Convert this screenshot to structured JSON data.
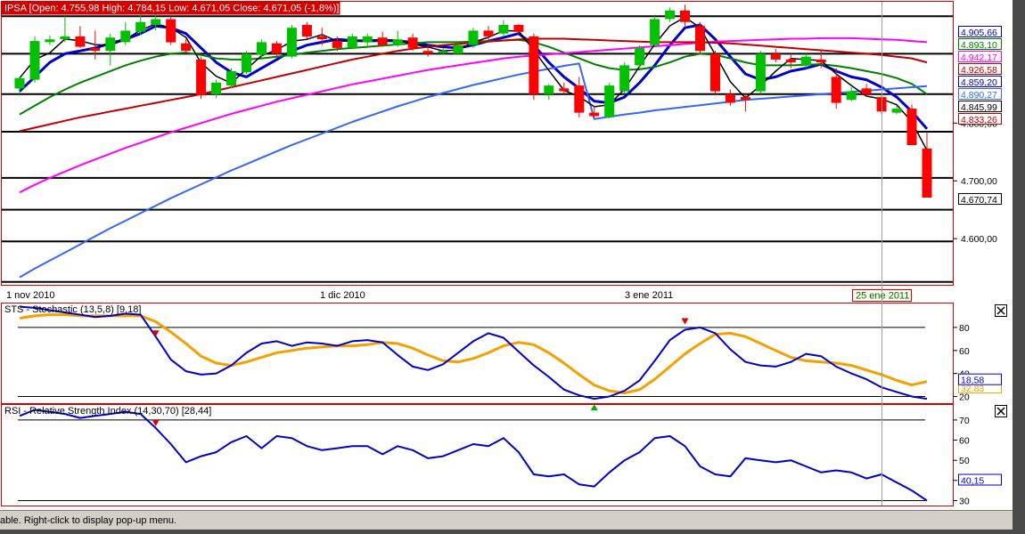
{
  "status_text": "able. Right-click to display pop-up menu.",
  "colors": {
    "panel_border": "#d40000",
    "up_candle": "#00c000",
    "down_candle": "#ff0000",
    "ma3": "#000000",
    "ma5": "#0000c8",
    "ma20": "#008000",
    "ma50": "#ff00ff",
    "ma40": "#c00000",
    "ma_long1": "#3366ff",
    "ma_long2": "#3366dd",
    "stoch_k": "#0000c8",
    "stoch_d": "#f5a000",
    "rsi": "#0000c8"
  },
  "panels": {
    "price": {
      "title": "IPSA [Open: 4.755,98  High: 4.784,15  Low: 4.671,05  Close: 4.671,05 (-1,8%)]",
      "y_ticks": [
        "4.800,00",
        "4.700,00",
        "4.600,00"
      ],
      "x_labels": [
        "1 nov 2010",
        "1 dic 2010",
        "3 ene 2011"
      ],
      "x_highlight_label": "25 ene 2011",
      "value_tags": [
        {
          "text": "4.905,66",
          "color": "#0000c8"
        },
        {
          "text": "4.893,10",
          "color": "#008000"
        },
        {
          "text": "4.942,17",
          "color": "#ff00ff"
        },
        {
          "text": "4.926,58",
          "color": "#c00000"
        },
        {
          "text": "4.859,20",
          "color": "#0000c8"
        },
        {
          "text": "4.890,27",
          "color": "#3366ff"
        },
        {
          "text": "4.845,99",
          "color": "#000000"
        },
        {
          "text": "4.833,26",
          "color": "#c00000"
        },
        {
          "text": "4.670,74",
          "color": "#000000"
        }
      ]
    },
    "stochastic": {
      "title": "STS - Stochastic (13,5,8) [9,18]",
      "y_ticks": [
        "80",
        "60",
        "40",
        "20"
      ],
      "value_tags": [
        {
          "text": "32,83",
          "color": "#f5a000"
        },
        {
          "text": "18,58",
          "color": "#0000c8"
        }
      ]
    },
    "rsi": {
      "title": "RSI - Relative Strength Index (14,30,70) [28,44]",
      "y_ticks": [
        "70",
        "60",
        "50",
        "40",
        "30"
      ],
      "value_tags": [
        {
          "text": "40,15",
          "color": "#0000c8"
        }
      ]
    }
  },
  "chart_data": [
    {
      "type": "candlestick",
      "title": "IPSA [Open: 4.755,98  High: 4.784,15  Low: 4.671,05  Close: 4.671,05 (-1,8%)]",
      "ylim": [
        4520,
        5010
      ],
      "y_ticks": [
        4800,
        4700,
        4600
      ],
      "x_labels": [
        {
          "label": "1 nov 2010",
          "index": 0
        },
        {
          "label": "1 dic 2010",
          "index": 21
        },
        {
          "label": "3 ene 2011",
          "index": 41
        },
        {
          "label": "25 ene 2011",
          "index": 57
        }
      ],
      "candles": [
        {
          "o": 4860,
          "h": 4880,
          "l": 4850,
          "c": 4878
        },
        {
          "o": 4875,
          "h": 4950,
          "l": 4870,
          "c": 4942
        },
        {
          "o": 4940,
          "h": 4952,
          "l": 4935,
          "c": 4945
        },
        {
          "o": 4945,
          "h": 4985,
          "l": 4940,
          "c": 4950
        },
        {
          "o": 4950,
          "h": 4968,
          "l": 4930,
          "c": 4932
        },
        {
          "o": 4930,
          "h": 4960,
          "l": 4910,
          "c": 4925
        },
        {
          "o": 4925,
          "h": 4955,
          "l": 4900,
          "c": 4948
        },
        {
          "o": 4940,
          "h": 4975,
          "l": 4935,
          "c": 4960
        },
        {
          "o": 4958,
          "h": 4995,
          "l": 4952,
          "c": 4975
        },
        {
          "o": 4970,
          "h": 4990,
          "l": 4960,
          "c": 4980
        },
        {
          "o": 4980,
          "h": 4985,
          "l": 4935,
          "c": 4940
        },
        {
          "o": 4938,
          "h": 4945,
          "l": 4920,
          "c": 4925
        },
        {
          "o": 4910,
          "h": 4915,
          "l": 4842,
          "c": 4848
        },
        {
          "o": 4850,
          "h": 4875,
          "l": 4843,
          "c": 4870
        },
        {
          "o": 4865,
          "h": 4895,
          "l": 4860,
          "c": 4890
        },
        {
          "o": 4888,
          "h": 4925,
          "l": 4885,
          "c": 4920
        },
        {
          "o": 4918,
          "h": 4945,
          "l": 4910,
          "c": 4940
        },
        {
          "o": 4938,
          "h": 4942,
          "l": 4915,
          "c": 4920
        },
        {
          "o": 4915,
          "h": 4970,
          "l": 4912,
          "c": 4965
        },
        {
          "o": 4970,
          "h": 4975,
          "l": 4945,
          "c": 4950
        },
        {
          "o": 4950,
          "h": 4965,
          "l": 4935,
          "c": 4945
        },
        {
          "o": 4942,
          "h": 4950,
          "l": 4925,
          "c": 4930
        },
        {
          "o": 4930,
          "h": 4955,
          "l": 4928,
          "c": 4950
        },
        {
          "o": 4940,
          "h": 4955,
          "l": 4932,
          "c": 4950
        },
        {
          "o": 4948,
          "h": 4958,
          "l": 4932,
          "c": 4935
        },
        {
          "o": 4935,
          "h": 4960,
          "l": 4932,
          "c": 4945
        },
        {
          "o": 4948,
          "h": 4955,
          "l": 4925,
          "c": 4930
        },
        {
          "o": 4925,
          "h": 4935,
          "l": 4915,
          "c": 4920
        },
        {
          "o": 4922,
          "h": 4930,
          "l": 4918,
          "c": 4925
        },
        {
          "o": 4920,
          "h": 4938,
          "l": 4918,
          "c": 4935
        },
        {
          "o": 4935,
          "h": 4965,
          "l": 4930,
          "c": 4960
        },
        {
          "o": 4960,
          "h": 4968,
          "l": 4945,
          "c": 4950
        },
        {
          "o": 4955,
          "h": 4978,
          "l": 4950,
          "c": 4970
        },
        {
          "o": 4970,
          "h": 4972,
          "l": 4955,
          "c": 4958
        },
        {
          "o": 4950,
          "h": 4955,
          "l": 4840,
          "c": 4850
        },
        {
          "o": 4850,
          "h": 4868,
          "l": 4840,
          "c": 4865
        },
        {
          "o": 4860,
          "h": 4870,
          "l": 4850,
          "c": 4855
        },
        {
          "o": 4865,
          "h": 4880,
          "l": 4810,
          "c": 4818
        },
        {
          "o": 4818,
          "h": 4830,
          "l": 4810,
          "c": 4812
        },
        {
          "o": 4810,
          "h": 4870,
          "l": 4808,
          "c": 4865
        },
        {
          "o": 4855,
          "h": 4905,
          "l": 4850,
          "c": 4900
        },
        {
          "o": 4900,
          "h": 4935,
          "l": 4895,
          "c": 4930
        },
        {
          "o": 4935,
          "h": 4985,
          "l": 4932,
          "c": 4980
        },
        {
          "o": 4980,
          "h": 5000,
          "l": 4975,
          "c": 4995
        },
        {
          "o": 4995,
          "h": 5005,
          "l": 4968,
          "c": 4975
        },
        {
          "o": 4968,
          "h": 4975,
          "l": 4920,
          "c": 4925
        },
        {
          "o": 4920,
          "h": 4925,
          "l": 4850,
          "c": 4855
        },
        {
          "o": 4850,
          "h": 4858,
          "l": 4830,
          "c": 4835
        },
        {
          "o": 4845,
          "h": 4852,
          "l": 4820,
          "c": 4840
        },
        {
          "o": 4855,
          "h": 4925,
          "l": 4850,
          "c": 4920
        },
        {
          "o": 4920,
          "h": 4928,
          "l": 4905,
          "c": 4910
        },
        {
          "o": 4910,
          "h": 4920,
          "l": 4895,
          "c": 4905
        },
        {
          "o": 4900,
          "h": 4920,
          "l": 4895,
          "c": 4915
        },
        {
          "o": 4910,
          "h": 4925,
          "l": 4895,
          "c": 4905
        },
        {
          "o": 4880,
          "h": 4895,
          "l": 4825,
          "c": 4835
        },
        {
          "o": 4840,
          "h": 4862,
          "l": 4838,
          "c": 4855
        },
        {
          "o": 4860,
          "h": 4868,
          "l": 4845,
          "c": 4850
        },
        {
          "o": 4845,
          "h": 4852,
          "l": 4815,
          "c": 4820
        },
        {
          "o": 4818,
          "h": 4830,
          "l": 4815,
          "c": 4825
        },
        {
          "o": 4825,
          "h": 4832,
          "l": 4780,
          "c": 4762
        },
        {
          "o": 4755.98,
          "h": 4784.15,
          "l": 4671.05,
          "c": 4671.05
        }
      ],
      "series": [
        {
          "name": "MA5",
          "values": [
            4855,
            4880,
            4905,
            4920,
            4925,
            4930,
            4938,
            4945,
            4955,
            4968,
            4965,
            4955,
            4930,
            4905,
            4888,
            4880,
            4895,
            4910,
            4925,
            4935,
            4940,
            4945,
            4943,
            4942,
            4943,
            4942,
            4940,
            4935,
            4932,
            4930,
            4935,
            4942,
            4948,
            4955,
            4935,
            4905,
            4880,
            4860,
            4838,
            4835,
            4845,
            4870,
            4900,
            4935,
            4965,
            4970,
            4945,
            4915,
            4885,
            4875,
            4880,
            4890,
            4895,
            4902,
            4890,
            4880,
            4875,
            4862,
            4845,
            4820,
            4790
          ]
        },
        {
          "name": "MA20",
          "values": [
            4815,
            4830,
            4845,
            4858,
            4870,
            4880,
            4890,
            4900,
            4908,
            4915,
            4920,
            4922,
            4918,
            4912,
            4910,
            4910,
            4912,
            4915,
            4918,
            4922,
            4925,
            4928,
            4930,
            4932,
            4934,
            4936,
            4938,
            4940,
            4940,
            4940,
            4941,
            4942,
            4943,
            4944,
            4940,
            4932,
            4922,
            4912,
            4902,
            4895,
            4892,
            4893,
            4897,
            4905,
            4915,
            4920,
            4918,
            4912,
            4905,
            4900,
            4900,
            4900,
            4901,
            4902,
            4899,
            4895,
            4890,
            4885,
            4878,
            4868,
            4850
          ]
        },
        {
          "name": "MA50",
          "values": [
            4680,
            4693,
            4705,
            4716,
            4727,
            4737,
            4747,
            4757,
            4766,
            4775,
            4784,
            4792,
            4800,
            4808,
            4816,
            4823,
            4830,
            4837,
            4843,
            4849,
            4855,
            4861,
            4867,
            4872,
            4877,
            4882,
            4887,
            4892,
            4896,
            4900,
            4904,
            4908,
            4912,
            4915,
            4917,
            4919,
            4921,
            4923,
            4925,
            4927,
            4929,
            4931,
            4933,
            4935,
            4937,
            4939,
            4941,
            4942,
            4943,
            4944,
            4945,
            4946,
            4946,
            4947,
            4947,
            4947,
            4946,
            4945,
            4944,
            4942,
            4940
          ]
        },
        {
          "name": "MA40",
          "values": [
            4786,
            4792,
            4798,
            4804,
            4810,
            4815,
            4820,
            4825,
            4830,
            4835,
            4840,
            4845,
            4850,
            4856,
            4862,
            4868,
            4874,
            4880,
            4886,
            4892,
            4898,
            4904,
            4910,
            4915,
            4920,
            4925,
            4929,
            4932,
            4935,
            4937,
            4939,
            4941,
            4943,
            4945,
            4946,
            4946,
            4946,
            4945,
            4944,
            4943,
            4942,
            4941,
            4940,
            4940,
            4940,
            4940,
            4939,
            4938,
            4936,
            4934,
            4932,
            4930,
            4928,
            4926,
            4924,
            4922,
            4920,
            4918,
            4915,
            4912,
            4905
          ]
        },
        {
          "name": "MA_long",
          "values": [
            4533,
            4548,
            4562,
            4576,
            4590,
            4604,
            4618,
            4631,
            4644,
            4657,
            4670,
            4682,
            4694,
            4706,
            4718,
            4729,
            4740,
            4751,
            4762,
            4772,
            4782,
            4792,
            4802,
            4811,
            4820,
            4829,
            4837,
            4845,
            4852,
            4859,
            4866,
            4872,
            4878,
            4884,
            4889,
            4894,
            4899,
            4903,
            4807,
            4811,
            4815,
            4818,
            4822,
            4825,
            4828,
            4831,
            4834,
            4837,
            4840,
            4842,
            4844,
            4846,
            4848,
            4850,
            4852,
            4854,
            4856,
            4858,
            4860,
            4862,
            4864
          ]
        }
      ]
    },
    {
      "type": "line",
      "title": "STS - Stochastic (13,5,8) [9,18]",
      "ylim": [
        15,
        100
      ],
      "y_ticks": [
        80,
        60,
        40,
        20
      ],
      "series": [
        {
          "name": "%K",
          "values": [
            98,
            97,
            95,
            93,
            91,
            89,
            90,
            92,
            91,
            72,
            52,
            42,
            39,
            40,
            47,
            58,
            66,
            68,
            64,
            67,
            66,
            64,
            68,
            69,
            67,
            56,
            46,
            43,
            48,
            58,
            68,
            75,
            71,
            59,
            47,
            37,
            26,
            21,
            18,
            20,
            25,
            34,
            51,
            69,
            78,
            80,
            75,
            61,
            50,
            47,
            46,
            50,
            57,
            55,
            46,
            40,
            35,
            28,
            24,
            20,
            18
          ]
        },
        {
          "name": "%D",
          "values": [
            88,
            90,
            91,
            91,
            90,
            90,
            90,
            90,
            90,
            85,
            76,
            66,
            55,
            49,
            47,
            50,
            54,
            58,
            60,
            62,
            63,
            64,
            64,
            65,
            67,
            66,
            62,
            56,
            51,
            50,
            53,
            58,
            64,
            67,
            65,
            58,
            49,
            39,
            30,
            25,
            23,
            26,
            35,
            46,
            57,
            66,
            74,
            75,
            72,
            66,
            60,
            54,
            51,
            50,
            49,
            47,
            43,
            39,
            34,
            30,
            33
          ]
        }
      ]
    },
    {
      "type": "line",
      "title": "RSI - Relative Strength Index (14,30,70) [28,44]",
      "ylim": [
        28,
        77
      ],
      "y_ticks": [
        70,
        60,
        50,
        40,
        30
      ],
      "series": [
        {
          "name": "RSI",
          "values": [
            72,
            75,
            74,
            73,
            71,
            72,
            73,
            74,
            73,
            66,
            58,
            49,
            52,
            54,
            59,
            62,
            56,
            62,
            61,
            57,
            55,
            56,
            57,
            57,
            53,
            57,
            55,
            51,
            52,
            55,
            58,
            57,
            61,
            54,
            43,
            42,
            43,
            38,
            37,
            44,
            50,
            54,
            61,
            62,
            57,
            47,
            43,
            42,
            51,
            50,
            49,
            50,
            47,
            44,
            45,
            44,
            41,
            43,
            39,
            35,
            30
          ]
        }
      ]
    }
  ]
}
